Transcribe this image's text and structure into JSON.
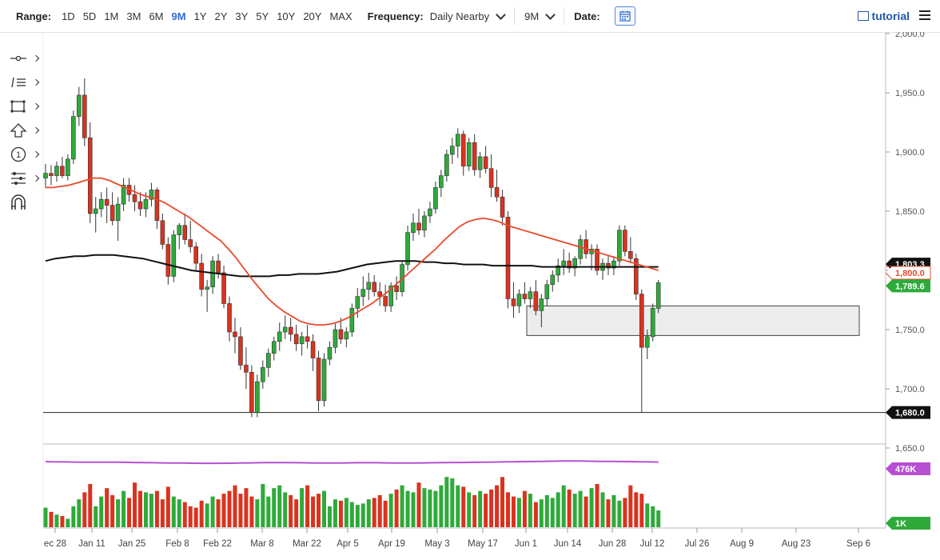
{
  "toolbar": {
    "range_label": "Range:",
    "ranges": [
      "1D",
      "5D",
      "1M",
      "3M",
      "6M",
      "9M",
      "1Y",
      "2Y",
      "3Y",
      "5Y",
      "10Y",
      "20Y",
      "MAX"
    ],
    "active_range": "9M",
    "frequency_label": "Frequency:",
    "frequency_value": "Daily Nearby",
    "period_value": "9M",
    "date_label": "Date:",
    "tutorial_label": "tutorial"
  },
  "tools": [
    "crosshair-icon",
    "trendline-icon",
    "shape-icon",
    "arrow-up-icon",
    "circle-number-icon",
    "fibonacci-icon",
    "magnet-icon"
  ],
  "chart_data": {
    "type": "candlestick",
    "ylim": [
      1650,
      2000
    ],
    "yticks": [
      "1,650.0",
      "1,700.0",
      "1,750.0",
      "1,800.0",
      "1,850.0",
      "1,900.0",
      "1,950.0",
      "2,000.0"
    ],
    "xtick_labels": [
      "ec 28",
      "Jan 11",
      "Jan 25",
      "Feb 8",
      "Feb 22",
      "Mar 8",
      "Mar 22",
      "Apr 5",
      "Apr 19",
      "May 3",
      "May 17",
      "Jun 1",
      "Jun 14",
      "Jun 28",
      "Jul 12",
      "Jul 26",
      "Aug 9",
      "Aug 23",
      "Sep 6"
    ],
    "colors": {
      "up": "#2eaa3a",
      "down": "#d9331f",
      "ma_short": "#e84a2a",
      "ma_long": "#111111",
      "volume_avg": "#b64fd3",
      "price_tag": "#2eaa3a"
    },
    "price_tags": {
      "last": "1,789.6",
      "ma_short": "1,800.0",
      "ma_long": "1,803.3",
      "support": "1,680.0"
    },
    "support_level": 1680,
    "zone": {
      "low": 1745,
      "high": 1770
    },
    "ohlc": [
      [
        1878,
        1890,
        1870,
        1882
      ],
      [
        1882,
        1889,
        1872,
        1880
      ],
      [
        1880,
        1892,
        1875,
        1888
      ],
      [
        1888,
        1896,
        1878,
        1880
      ],
      [
        1880,
        1898,
        1876,
        1894
      ],
      [
        1894,
        1935,
        1890,
        1930
      ],
      [
        1930,
        1955,
        1922,
        1948
      ],
      [
        1948,
        1962,
        1905,
        1912
      ],
      [
        1912,
        1925,
        1840,
        1848
      ],
      [
        1848,
        1862,
        1832,
        1852
      ],
      [
        1852,
        1866,
        1845,
        1860
      ],
      [
        1860,
        1870,
        1840,
        1855
      ],
      [
        1855,
        1866,
        1838,
        1842
      ],
      [
        1842,
        1862,
        1825,
        1856
      ],
      [
        1856,
        1878,
        1850,
        1872
      ],
      [
        1872,
        1878,
        1858,
        1864
      ],
      [
        1864,
        1872,
        1850,
        1858
      ],
      [
        1858,
        1866,
        1846,
        1852
      ],
      [
        1852,
        1866,
        1845,
        1860
      ],
      [
        1860,
        1874,
        1854,
        1868
      ],
      [
        1868,
        1870,
        1835,
        1842
      ],
      [
        1842,
        1848,
        1818,
        1822
      ],
      [
        1822,
        1828,
        1788,
        1795
      ],
      [
        1795,
        1834,
        1790,
        1830
      ],
      [
        1830,
        1840,
        1818,
        1838
      ],
      [
        1838,
        1848,
        1822,
        1826
      ],
      [
        1826,
        1842,
        1815,
        1820
      ],
      [
        1820,
        1824,
        1800,
        1806
      ],
      [
        1806,
        1814,
        1778,
        1784
      ],
      [
        1784,
        1792,
        1765,
        1786
      ],
      [
        1786,
        1812,
        1780,
        1808
      ],
      [
        1808,
        1814,
        1793,
        1798
      ],
      [
        1798,
        1804,
        1768,
        1772
      ],
      [
        1772,
        1778,
        1740,
        1748
      ],
      [
        1748,
        1760,
        1730,
        1744
      ],
      [
        1744,
        1752,
        1716,
        1720
      ],
      [
        1720,
        1735,
        1700,
        1714
      ],
      [
        1714,
        1720,
        1676,
        1680
      ],
      [
        1680,
        1712,
        1676,
        1706
      ],
      [
        1706,
        1724,
        1700,
        1718
      ],
      [
        1718,
        1734,
        1710,
        1730
      ],
      [
        1730,
        1744,
        1724,
        1740
      ],
      [
        1740,
        1756,
        1732,
        1748
      ],
      [
        1748,
        1762,
        1742,
        1752
      ],
      [
        1752,
        1760,
        1740,
        1746
      ],
      [
        1746,
        1754,
        1732,
        1738
      ],
      [
        1738,
        1748,
        1728,
        1744
      ],
      [
        1744,
        1754,
        1734,
        1740
      ],
      [
        1740,
        1746,
        1715,
        1726
      ],
      [
        1726,
        1732,
        1681,
        1690
      ],
      [
        1690,
        1730,
        1685,
        1725
      ],
      [
        1725,
        1740,
        1720,
        1735
      ],
      [
        1735,
        1755,
        1730,
        1750
      ],
      [
        1750,
        1760,
        1738,
        1742
      ],
      [
        1742,
        1752,
        1735,
        1748
      ],
      [
        1748,
        1772,
        1744,
        1768
      ],
      [
        1768,
        1785,
        1760,
        1778
      ],
      [
        1778,
        1795,
        1770,
        1784
      ],
      [
        1784,
        1798,
        1775,
        1790
      ],
      [
        1790,
        1796,
        1778,
        1782
      ],
      [
        1782,
        1790,
        1770,
        1778
      ],
      [
        1778,
        1788,
        1765,
        1770
      ],
      [
        1770,
        1790,
        1765,
        1787
      ],
      [
        1787,
        1795,
        1775,
        1782
      ],
      [
        1782,
        1808,
        1778,
        1805
      ],
      [
        1805,
        1838,
        1800,
        1832
      ],
      [
        1832,
        1848,
        1825,
        1840
      ],
      [
        1840,
        1852,
        1830,
        1834
      ],
      [
        1834,
        1850,
        1828,
        1846
      ],
      [
        1846,
        1858,
        1840,
        1852
      ],
      [
        1852,
        1875,
        1848,
        1870
      ],
      [
        1870,
        1885,
        1862,
        1880
      ],
      [
        1880,
        1902,
        1875,
        1898
      ],
      [
        1898,
        1912,
        1890,
        1905
      ],
      [
        1905,
        1920,
        1895,
        1915
      ],
      [
        1915,
        1918,
        1880,
        1888
      ],
      [
        1888,
        1912,
        1884,
        1908
      ],
      [
        1908,
        1915,
        1880,
        1885
      ],
      [
        1885,
        1900,
        1878,
        1896
      ],
      [
        1896,
        1905,
        1882,
        1886
      ],
      [
        1886,
        1898,
        1862,
        1870
      ],
      [
        1870,
        1885,
        1858,
        1862
      ],
      [
        1862,
        1868,
        1838,
        1845
      ],
      [
        1845,
        1850,
        1768,
        1776
      ],
      [
        1776,
        1790,
        1760,
        1770
      ],
      [
        1770,
        1784,
        1764,
        1780
      ],
      [
        1780,
        1790,
        1772,
        1776
      ],
      [
        1776,
        1786,
        1768,
        1782
      ],
      [
        1782,
        1792,
        1762,
        1766
      ],
      [
        1766,
        1780,
        1752,
        1776
      ],
      [
        1776,
        1792,
        1770,
        1788
      ],
      [
        1788,
        1800,
        1782,
        1796
      ],
      [
        1796,
        1810,
        1790,
        1804
      ],
      [
        1804,
        1818,
        1796,
        1808
      ],
      [
        1808,
        1815,
        1798,
        1802
      ],
      [
        1802,
        1812,
        1795,
        1810
      ],
      [
        1810,
        1830,
        1805,
        1826
      ],
      [
        1826,
        1834,
        1810,
        1814
      ],
      [
        1814,
        1822,
        1800,
        1818
      ],
      [
        1818,
        1822,
        1796,
        1800
      ],
      [
        1800,
        1810,
        1792,
        1806
      ],
      [
        1806,
        1812,
        1796,
        1802
      ],
      [
        1802,
        1812,
        1796,
        1808
      ],
      [
        1808,
        1838,
        1804,
        1834
      ],
      [
        1834,
        1838,
        1812,
        1816
      ],
      [
        1816,
        1828,
        1806,
        1810
      ],
      [
        1810,
        1814,
        1775,
        1780
      ],
      [
        1780,
        1784,
        1680,
        1735
      ],
      [
        1735,
        1750,
        1725,
        1744
      ],
      [
        1744,
        1772,
        1740,
        1768
      ],
      [
        1768,
        1792,
        1764,
        1789.6
      ]
    ],
    "ma_short": [
      1870,
      1870,
      1871,
      1872,
      1874,
      1876,
      1878,
      1878,
      1876,
      1873,
      1870,
      1867,
      1864,
      1862,
      1860,
      1857,
      1853,
      1849,
      1845,
      1840,
      1835,
      1830,
      1825,
      1818,
      1810,
      1801,
      1792,
      1784,
      1776,
      1770,
      1765,
      1761,
      1757,
      1755,
      1754,
      1754,
      1755,
      1757,
      1760,
      1764,
      1768,
      1772,
      1777,
      1782,
      1788,
      1794,
      1800,
      1806,
      1812,
      1818,
      1825,
      1831,
      1837,
      1841,
      1843,
      1844,
      1843,
      1841,
      1838,
      1836,
      1834,
      1832,
      1830,
      1828,
      1826,
      1824,
      1822,
      1820,
      1818,
      1816,
      1814,
      1812,
      1810,
      1808,
      1806,
      1804,
      1802,
      1800
    ],
    "ma_long": [
      1808,
      1810,
      1811,
      1812,
      1812,
      1813,
      1813,
      1813,
      1812,
      1811,
      1810,
      1808,
      1806,
      1804,
      1802,
      1800,
      1799,
      1798,
      1797,
      1796,
      1795,
      1795,
      1795,
      1795,
      1796,
      1796,
      1797,
      1797,
      1797,
      1798,
      1799,
      1801,
      1803,
      1805,
      1806,
      1807,
      1808,
      1808,
      1808,
      1807,
      1807,
      1806,
      1806,
      1805,
      1805,
      1805,
      1804,
      1804,
      1804,
      1804,
      1804,
      1803,
      1803,
      1803,
      1803,
      1803,
      1803,
      1803,
      1803,
      1803,
      1803,
      1803,
      1803,
      1803
    ],
    "volume": {
      "max_label": "476K",
      "min_label": "1K",
      "values": [
        140,
        110,
        90,
        80,
        60,
        150,
        200,
        250,
        310,
        150,
        220,
        280,
        230,
        200,
        260,
        210,
        320,
        260,
        250,
        240,
        260,
        200,
        290,
        220,
        200,
        180,
        150,
        140,
        190,
        170,
        220,
        200,
        240,
        260,
        300,
        240,
        280,
        220,
        200,
        310,
        220,
        280,
        300,
        250,
        230,
        200,
        280,
        300,
        220,
        240,
        260,
        150,
        200,
        190,
        210,
        180,
        160,
        170,
        200,
        210,
        230,
        190,
        240,
        270,
        300,
        260,
        250,
        320,
        280,
        270,
        260,
        300,
        360,
        350,
        300,
        290,
        250,
        230,
        260,
        240,
        270,
        300,
        360,
        250,
        220,
        210,
        260,
        240,
        180,
        200,
        230,
        210,
        250,
        300,
        270,
        240,
        260,
        220,
        280,
        310,
        250,
        200,
        230,
        190,
        210,
        300,
        250,
        240,
        170,
        150,
        120
      ],
      "avg": [
        470,
        468,
        468,
        467,
        466,
        466,
        466,
        466,
        465,
        464,
        463,
        462,
        461,
        460,
        460,
        459,
        458,
        458,
        458,
        459,
        460,
        461,
        462,
        463,
        463,
        463,
        462,
        461,
        460,
        460,
        460,
        461,
        462,
        462,
        462,
        461,
        460,
        460,
        460,
        461,
        462,
        463,
        464,
        464,
        465,
        466,
        467,
        468,
        469,
        470,
        471,
        472,
        473,
        474,
        474,
        474,
        473,
        472,
        472,
        471,
        470,
        469,
        468,
        467
      ]
    }
  }
}
